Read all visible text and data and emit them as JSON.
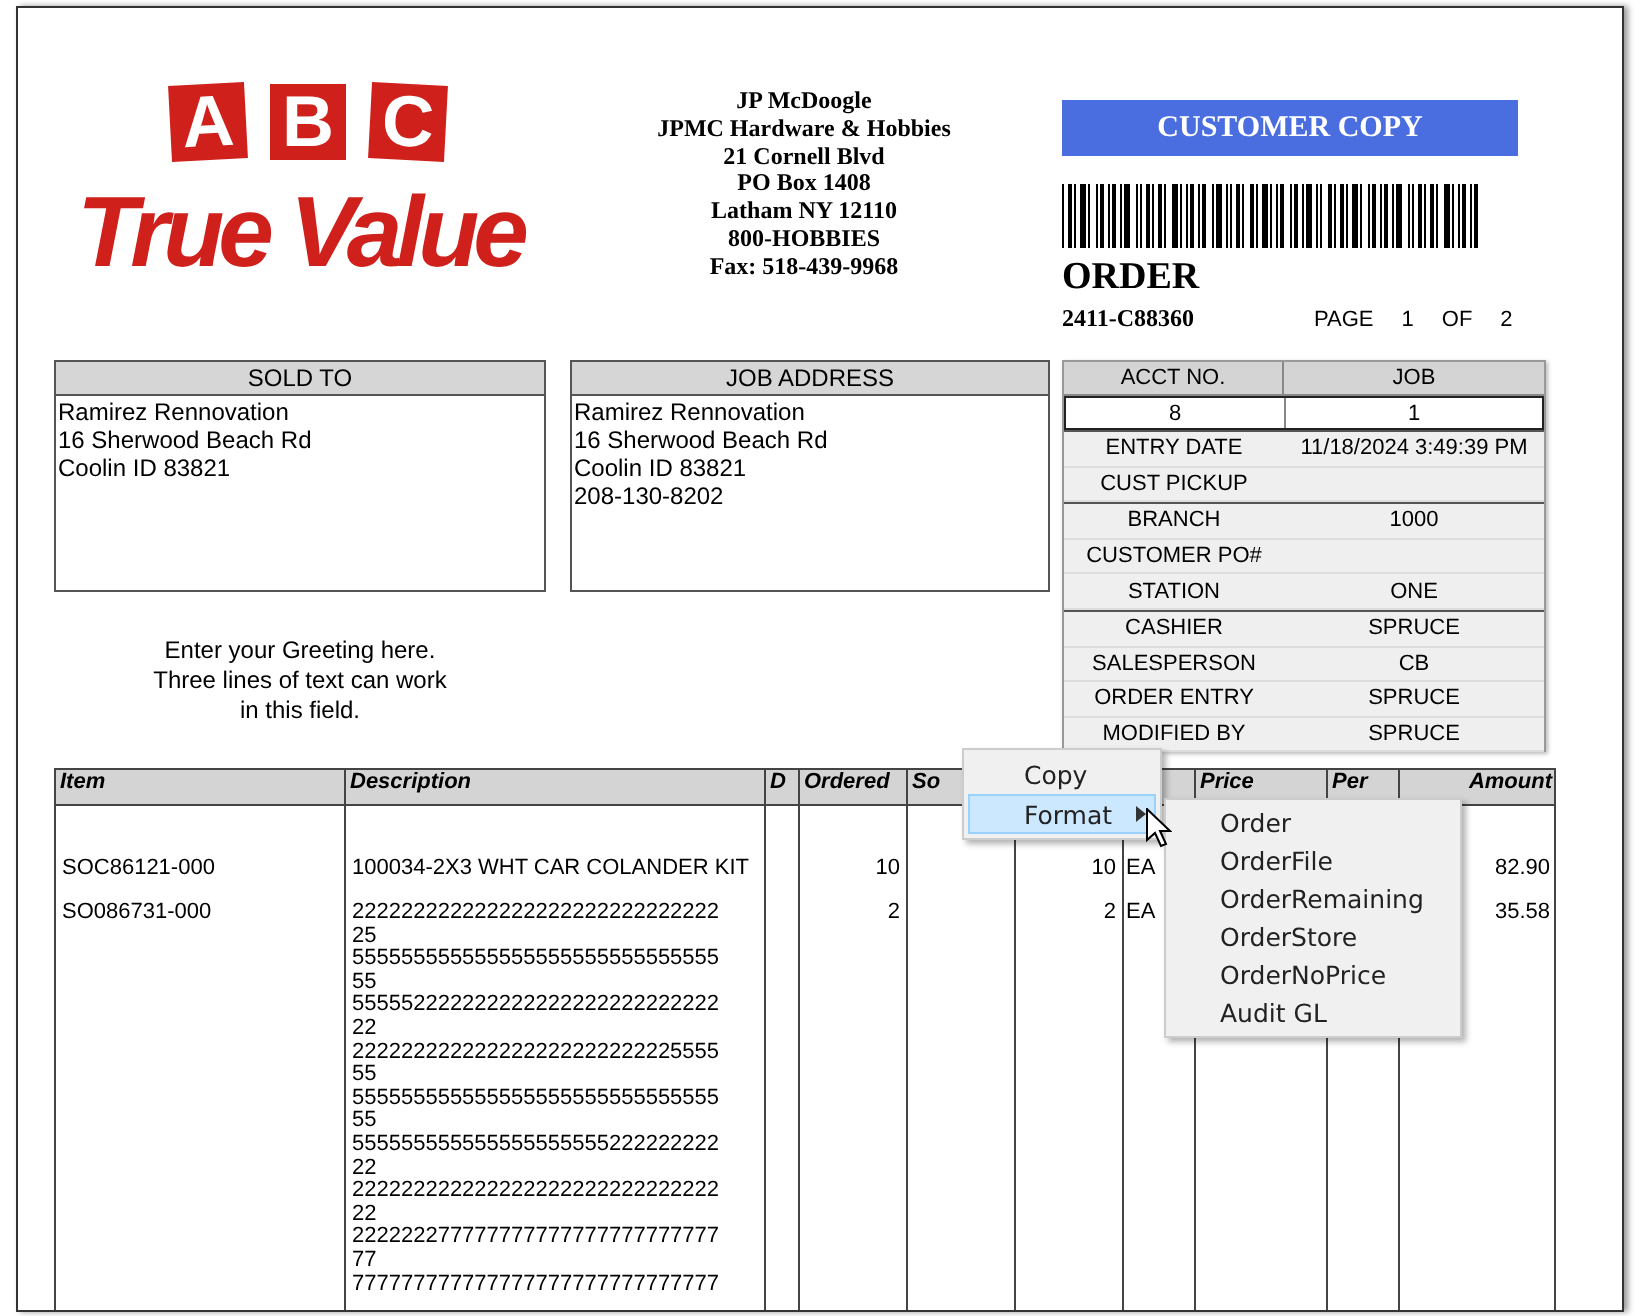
{
  "logo": {
    "letters": [
      "A",
      "B",
      "C"
    ],
    "wordmark": "True Value"
  },
  "store": {
    "lines": [
      "JP McDoogle",
      "JPMC Hardware & Hobbies",
      "21 Cornell Blvd",
      "PO Box 1408",
      "Latham NY 12110",
      "800-HOBBIES",
      "Fax: 518-439-9968"
    ]
  },
  "copy_label": "CUSTOMER COPY",
  "document": {
    "title": "ORDER",
    "number": "2411-C88360",
    "page_label": "PAGE",
    "page": "1",
    "of_label": "OF",
    "pages": "2"
  },
  "sold_to": {
    "heading": "SOLD TO",
    "lines": [
      "Ramirez Rennovation",
      "16 Sherwood Beach Rd",
      "Coolin ID 83821"
    ]
  },
  "job_address": {
    "heading": "JOB ADDRESS",
    "lines": [
      "Ramirez Rennovation",
      "16 Sherwood Beach Rd",
      "Coolin ID 83821",
      "208-130-8202"
    ]
  },
  "account": {
    "headings": [
      "ACCT NO.",
      "JOB"
    ],
    "values": [
      "8",
      "1"
    ]
  },
  "details": [
    [
      {
        "label": "ENTRY DATE",
        "value": "11/18/2024 3:49:39 PM"
      },
      {
        "label": "CUST PICKUP"
      }
    ],
    [
      {
        "label": "BRANCH",
        "value": "1000"
      },
      {
        "label": "CUSTOMER PO#"
      },
      {
        "label": "STATION",
        "value": "ONE"
      }
    ],
    [
      {
        "label": "CASHIER",
        "value": "SPRUCE"
      },
      {
        "label": "SALESPERSON",
        "value": "CB"
      },
      {
        "label": "ORDER ENTRY",
        "value": "SPRUCE"
      },
      {
        "label": "MODIFIED BY",
        "value": "SPRUCE"
      }
    ]
  ],
  "greeting": [
    "Enter your Greeting here.",
    "Three lines of text can work",
    "in this field."
  ],
  "items": {
    "columns": [
      "Item",
      "Description",
      "D",
      "Ordered",
      "So",
      null,
      null,
      "Price",
      "Per",
      "Amount"
    ],
    "rows": [
      {
        "item": "SOC86121-000",
        "description": [
          "100034-2X3 WHT CAR COLANDER KIT"
        ],
        "ordered": "10",
        "column_6": "10",
        "column_7": "EA",
        "amount": "82.90"
      },
      {
        "item": "SO086731-000",
        "description": [
          "222222222222222222222222222222",
          "25",
          "555555555555555555555555555555",
          "55",
          "555552222222222222222222222222",
          "22",
          "222222222222222222222222225555",
          "55",
          "555555555555555555555555555555",
          "55",
          "555555555555555555555222222222",
          "22",
          "222222222222222222222222222222",
          "22",
          "222222277777777777777777777777",
          "77",
          "777777777777777777777777777777"
        ],
        "ordered": "2",
        "column_6": "2",
        "column_7": "EA",
        "amount": "35.58"
      }
    ]
  },
  "context_menu": {
    "items": [
      {
        "label": "Copy",
        "selected": false,
        "submenu": false
      },
      {
        "label": "Format",
        "selected": true,
        "submenu": true
      }
    ],
    "submenu": [
      "Order",
      "OrderFile",
      "OrderRemaining",
      "OrderStore",
      "OrderNoPrice",
      "Audit GL"
    ]
  }
}
